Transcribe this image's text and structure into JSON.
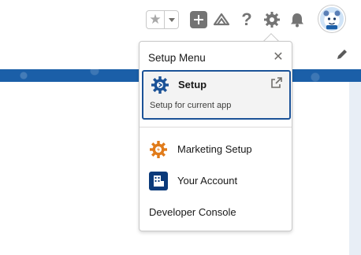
{
  "header": {
    "favorites_star": "★",
    "help_glyph": "?"
  },
  "setup_menu": {
    "title": "Setup Menu",
    "close_glyph": "✕",
    "primary_item": {
      "label": "Setup",
      "description": "Setup for current app",
      "icon": "setup-gear-icon"
    },
    "items": [
      {
        "label": "Marketing Setup",
        "icon": "marketing-gear-icon"
      },
      {
        "label": "Your Account",
        "icon": "account-building-icon"
      },
      {
        "label": "Developer Console"
      }
    ]
  },
  "colors": {
    "band": "#1b5fa8",
    "selected_border": "#1b5297",
    "setup_icon": "#1b5297",
    "marketing_icon": "#e07b1a",
    "account_icon": "#0b3a7a",
    "header_icon": "#747474"
  }
}
